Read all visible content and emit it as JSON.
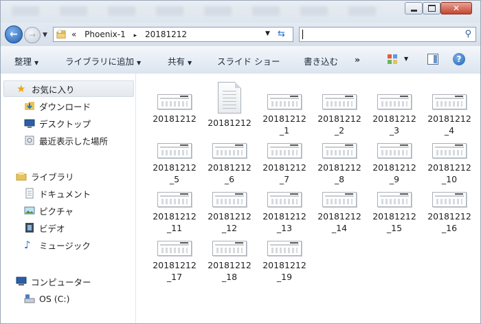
{
  "window": {
    "min_glyph": "",
    "close_glyph": "✕"
  },
  "nav": {
    "breadcrumb_sep": "«",
    "crumbs": [
      "Phoenix-1",
      "▸",
      "20181212"
    ],
    "search_placeholder": "",
    "icons": [
      "back-arrow-icon",
      "forward-arrow-icon",
      "folder-icon",
      "refresh-icon",
      "search-icon"
    ]
  },
  "toolbar": {
    "organize": "整理",
    "add_to_library": "ライブラリに追加",
    "share": "共有",
    "slideshow": "スライド ショー",
    "burn": "書き込む",
    "more": "»",
    "help": "?"
  },
  "sidebar": {
    "favorites": {
      "label": "お気に入り",
      "items": [
        "ダウンロード",
        "デスクトップ",
        "最近表示した場所"
      ]
    },
    "libraries": {
      "label": "ライブラリ",
      "items": [
        "ドキュメント",
        "ピクチャ",
        "ビデオ",
        "ミュージック"
      ]
    },
    "computer": {
      "label": "コンピューター",
      "items": [
        "OS (C:)"
      ]
    }
  },
  "files": [
    {
      "line1": "20181212",
      "line2": "",
      "icon": "image-thumbnail"
    },
    {
      "line1": "20181212",
      "line2": "",
      "icon": "text-document"
    },
    {
      "line1": "20181212",
      "line2": "_1",
      "icon": "image-thumbnail"
    },
    {
      "line1": "20181212",
      "line2": "_2",
      "icon": "image-thumbnail"
    },
    {
      "line1": "20181212",
      "line2": "_3",
      "icon": "image-thumbnail"
    },
    {
      "line1": "20181212",
      "line2": "_4",
      "icon": "image-thumbnail"
    },
    {
      "line1": "20181212",
      "line2": "_5",
      "icon": "image-thumbnail"
    },
    {
      "line1": "20181212",
      "line2": "_6",
      "icon": "image-thumbnail"
    },
    {
      "line1": "20181212",
      "line2": "_7",
      "icon": "image-thumbnail"
    },
    {
      "line1": "20181212",
      "line2": "_8",
      "icon": "image-thumbnail"
    },
    {
      "line1": "20181212",
      "line2": "_9",
      "icon": "image-thumbnail"
    },
    {
      "line1": "20181212",
      "line2": "_10",
      "icon": "image-thumbnail"
    },
    {
      "line1": "20181212",
      "line2": "_11",
      "icon": "image-thumbnail"
    },
    {
      "line1": "20181212",
      "line2": "_12",
      "icon": "image-thumbnail"
    },
    {
      "line1": "20181212",
      "line2": "_13",
      "icon": "image-thumbnail"
    },
    {
      "line1": "20181212",
      "line2": "_14",
      "icon": "image-thumbnail"
    },
    {
      "line1": "20181212",
      "line2": "_15",
      "icon": "image-thumbnail"
    },
    {
      "line1": "20181212",
      "line2": "_16",
      "icon": "image-thumbnail"
    },
    {
      "line1": "20181212",
      "line2": "_17",
      "icon": "image-thumbnail"
    },
    {
      "line1": "20181212",
      "line2": "_18",
      "icon": "image-thumbnail"
    },
    {
      "line1": "20181212",
      "line2": "_19",
      "icon": "image-thumbnail"
    }
  ]
}
